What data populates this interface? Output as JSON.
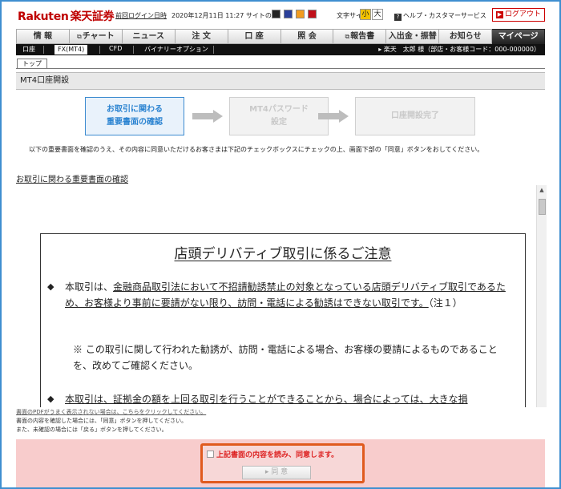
{
  "header": {
    "logo_en": "Rakuten",
    "logo_jp": "楽天証券",
    "last_login_label": "前回ログイン日時",
    "last_login_value": "2020年12月11日 11:27",
    "site_color_label": "サイトの色",
    "site_colors": [
      "#222222",
      "#2a3f9a",
      "#f29c1f",
      "#c0101a"
    ],
    "font_size_label": "文字サイズ",
    "font_small": "小",
    "font_large": "大",
    "help_label": "ヘルプ・カスタマーサービス",
    "logout_label": "ログアウト"
  },
  "nav": {
    "items": [
      "情 報",
      "チャート",
      "ニュース",
      "注 文",
      "口 座",
      "照 会",
      "報告書",
      "入出金・振替",
      "お知らせ",
      "マイページ"
    ]
  },
  "subnav": {
    "items": [
      "口座",
      "FX(MT4)",
      "CFD",
      "バイナリーオプション"
    ],
    "user": "楽天　太郎 様（部店・お客様コード：000-000000）"
  },
  "breadcrumb": "トップ",
  "page_title": "MT4口座開設",
  "steps": [
    {
      "line1": "お取引に関わる",
      "line2": "重要書面の確認"
    },
    {
      "line1": "MT4パスワード",
      "line2": "設定"
    },
    {
      "line1": "口座開設完了",
      "line2": ""
    }
  ],
  "instruction": "以下の重要書面を確認のうえ、その内容に同意いただけるお客さまは下記のチェックボックスにチェックの上、画面下部の「同意」ボタンをおしてください。",
  "doc_link": "お取引に関わる重要書面の確認",
  "document": {
    "title": "店頭デリバティブ取引に係るご注意",
    "p1_pre": "本取引は、",
    "p1_u": "金融商品取引法において不招請勧誘禁止の対象となっている店頭デリバティブ取引であるため、お客様より事前に要請がない限り、訪問・電話による勧誘はできない取引です。",
    "p1_post": "（注１）",
    "p2": "※ この取引に関して行われた勧誘が、訪問・電話による場合、お客様の要請によるものであることを、改めてご確認ください。",
    "p3": "本取引は、証拠金の額を上回る取引を行うことができることから、場合によっては、大きな損"
  },
  "notes": [
    "書面のPDFがうまく表示されない場合は、こちらをクリックしてください。",
    "書面の内容を確認した場合には、「同意」ボタンを押してください。",
    "また、未確認の場合には「戻る」ボタンを押してください。"
  ],
  "agree": {
    "checkbox_label": "上記書面の内容を読み、同意します。",
    "button_label": "同 意"
  }
}
